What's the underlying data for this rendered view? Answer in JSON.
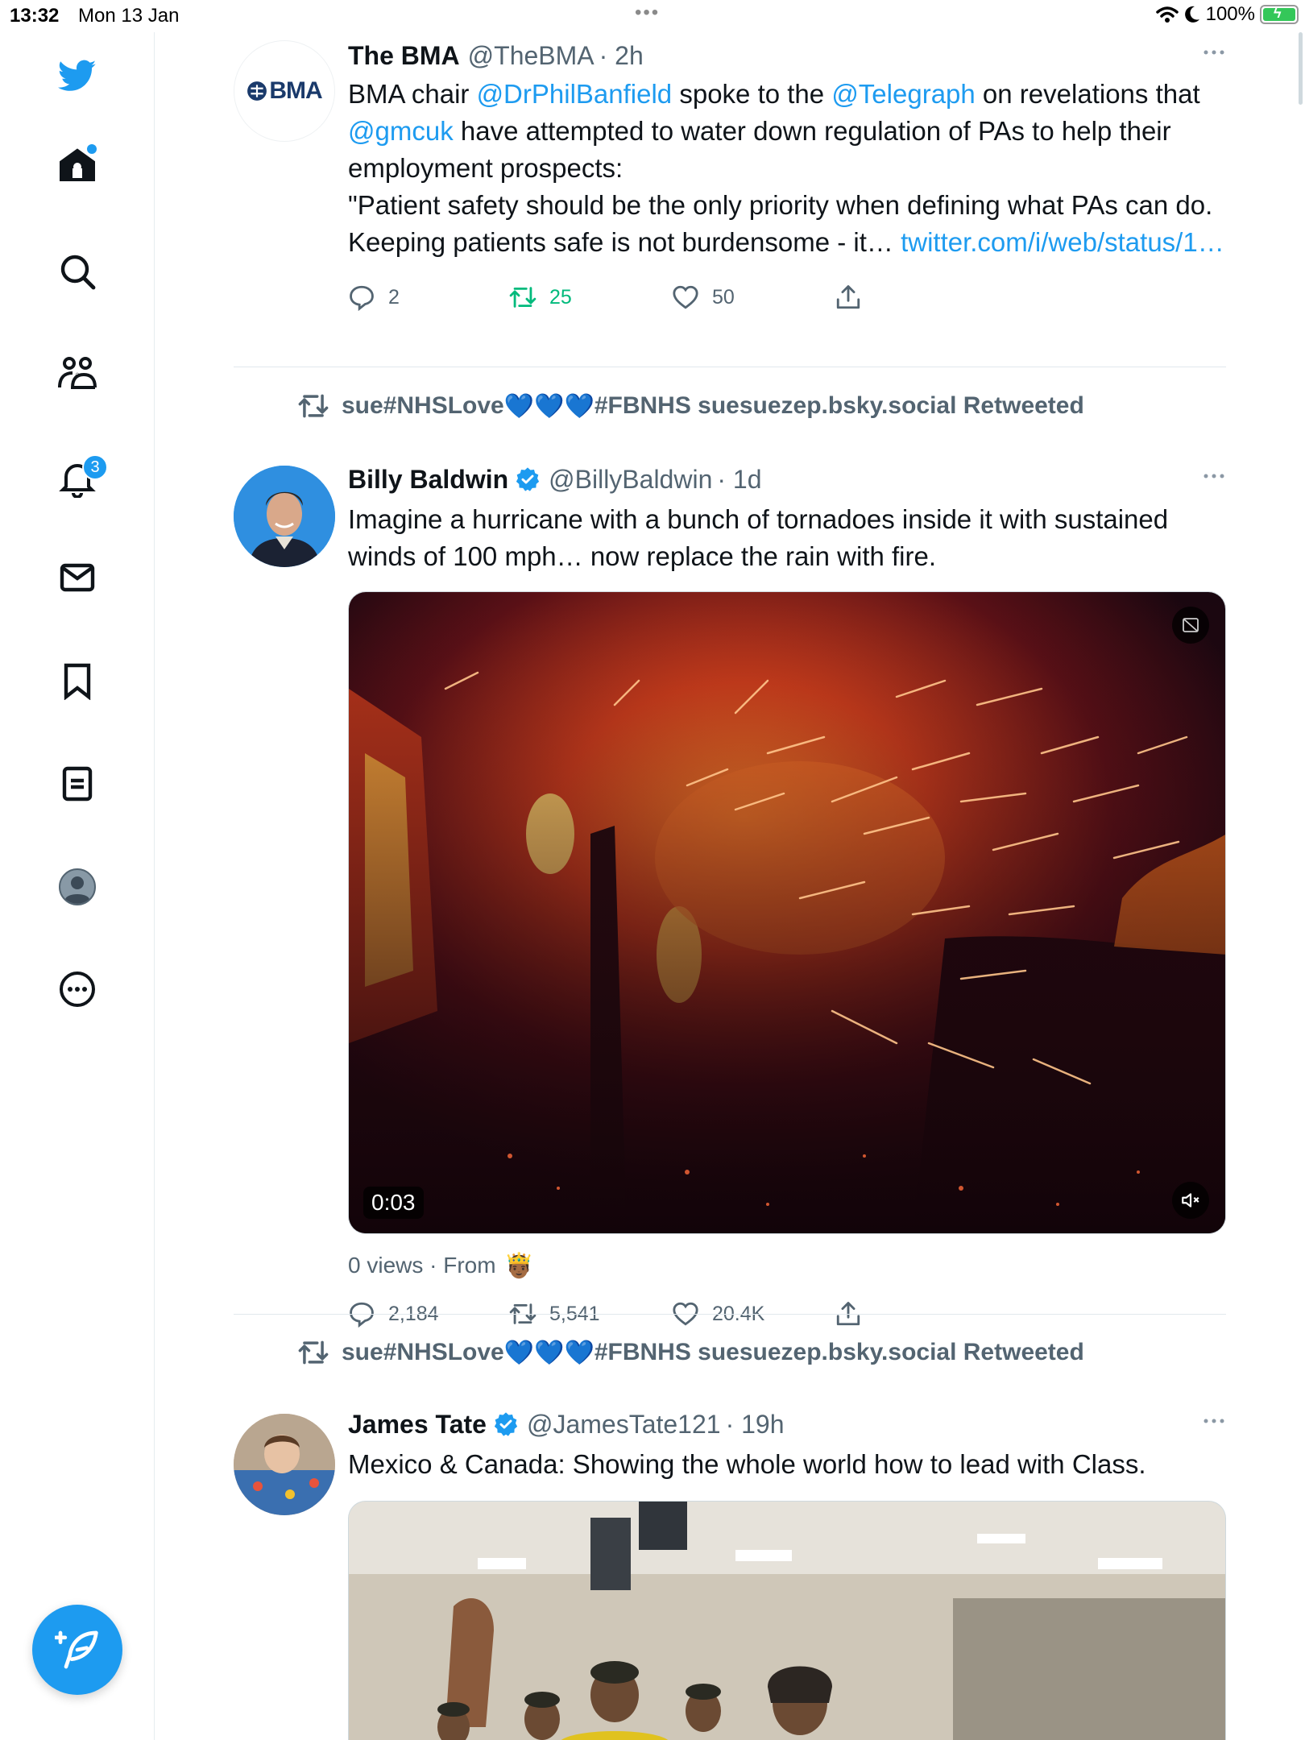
{
  "status_bar": {
    "time": "13:32",
    "date": "Mon 13 Jan",
    "battery_percent": "100%",
    "multitask_dots": "•••"
  },
  "sidebar": {
    "items": [
      {
        "name": "twitter-logo-icon"
      },
      {
        "name": "home-icon"
      },
      {
        "name": "search-icon"
      },
      {
        "name": "communities-icon"
      },
      {
        "name": "notifications-icon",
        "badge": "3"
      },
      {
        "name": "messages-icon"
      },
      {
        "name": "bookmarks-icon"
      },
      {
        "name": "lists-icon"
      },
      {
        "name": "profile-icon"
      },
      {
        "name": "more-icon"
      }
    ],
    "compose_label": "Compose"
  },
  "colors": {
    "accent": "#1d9bf0",
    "retweet_green": "#00ba7c",
    "secondary_text": "#536471"
  },
  "tweets": [
    {
      "author_name": "The BMA",
      "handle": "@TheBMA",
      "time": "· 2h",
      "avatar_text": "BMA",
      "text_parts": {
        "p1": "BMA chair ",
        "m1": "@DrPhilBanfield",
        "p2": " spoke to the ",
        "m2": "@Telegraph",
        "p3": " on revelations that ",
        "m3": "@gmcuk",
        "p4": " have attempted to water down regulation of PAs to help their employment prospects:",
        "p5": "\"Patient safety should be the only priority when defining what PAs can do. Keeping patients safe is not burdensome - it… ",
        "l1": "twitter.com/i/web/status/1…"
      },
      "replies": "2",
      "retweets": "25",
      "likes": "50"
    },
    {
      "retweeted_by_prefix": "sue#NHSLove",
      "retweeted_by_suffix": "#FBNHS suesuezep.bsky.social Retweeted",
      "hearts": "💙💙💙",
      "author_name": "Billy Baldwin",
      "handle": "@BillyBaldwin",
      "time": "· 1d",
      "text": "Imagine a hurricane with a bunch of tornadoes inside it with sustained winds of 100 mph… now replace the rain with fire.",
      "video_time": "0:03",
      "views": "0 views · From",
      "views_emoji": "🤴🏾",
      "replies": "2,184",
      "retweets": "5,541",
      "likes": "20.4K"
    },
    {
      "retweeted_by_prefix": "sue#NHSLove",
      "retweeted_by_suffix": "#FBNHS suesuezep.bsky.social Retweeted",
      "hearts": "💙💙💙",
      "author_name": "James Tate",
      "handle": "@JamesTate121",
      "time": "· 19h",
      "text": "Mexico & Canada: Showing the whole world how to lead with Class."
    }
  ]
}
